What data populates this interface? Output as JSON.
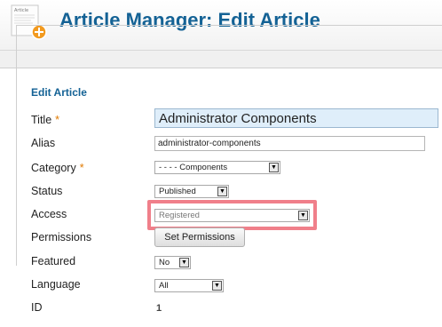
{
  "header": {
    "title": "Article Manager: Edit Article",
    "icon": "article-add-icon",
    "icon_caption": "Article"
  },
  "form": {
    "legend": "Edit Article",
    "title": {
      "label": "Title",
      "required_mark": "*",
      "value": "Administrator Components"
    },
    "alias": {
      "label": "Alias",
      "value": "administrator-components"
    },
    "category": {
      "label": "Category",
      "required_mark": "*",
      "value": "- - - - Components"
    },
    "status": {
      "label": "Status",
      "value": "Published"
    },
    "access": {
      "label": "Access",
      "value": "Registered"
    },
    "permissions": {
      "label": "Permissions",
      "button_label": "Set Permissions"
    },
    "featured": {
      "label": "Featured",
      "value": "No"
    },
    "language": {
      "label": "Language",
      "value": "All"
    },
    "id": {
      "label": "ID",
      "value": "1"
    }
  },
  "colors": {
    "title": "#146295",
    "highlight": "#f07f8a",
    "required": "#e07a00"
  }
}
